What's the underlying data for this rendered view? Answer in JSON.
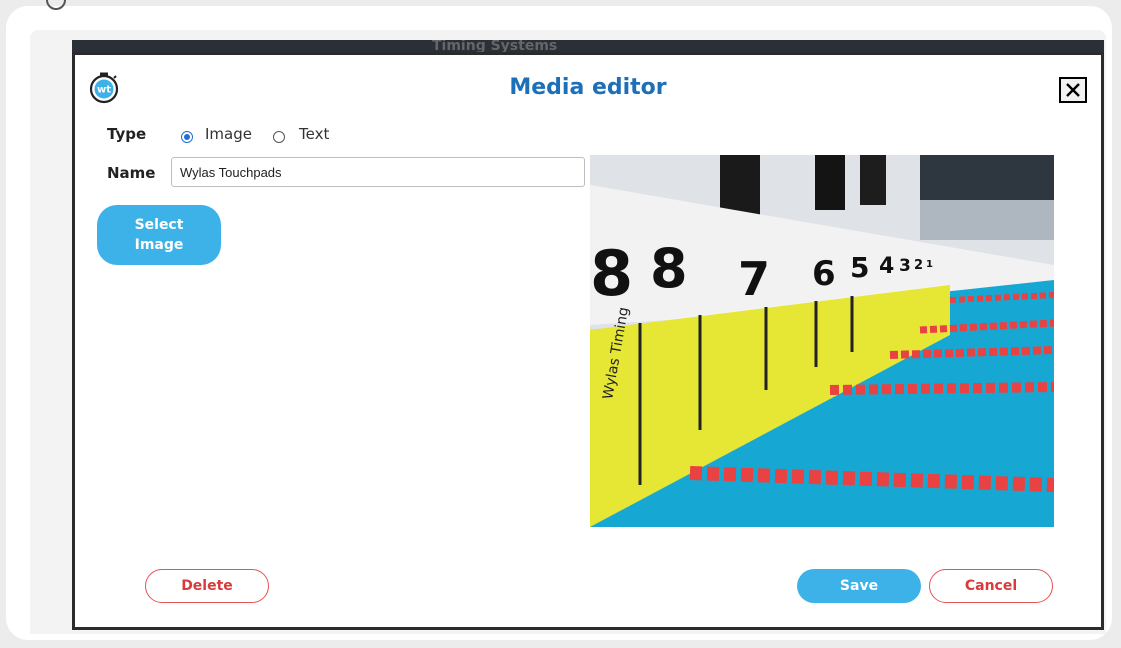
{
  "modal": {
    "title": "Media editor",
    "logo_text": "wt",
    "close_label": "✕"
  },
  "form": {
    "type_label": "Type",
    "type_options": [
      "Image",
      "Text"
    ],
    "type_selected": "Image",
    "name_label": "Name",
    "name_value": "Wylas Touchpads",
    "select_image_label_line1": "Select",
    "select_image_label_line2": "Image"
  },
  "preview": {
    "lane_numbers": [
      "8",
      "8",
      "7",
      "6",
      "5",
      "4",
      "3",
      "2",
      "1"
    ],
    "touchpad_brand": "Wylas Timing"
  },
  "buttons": {
    "delete": "Delete",
    "save": "Save",
    "cancel": "Cancel"
  },
  "background": {
    "partial_text": "Timing Systems"
  },
  "colors": {
    "title": "#1d6fb8",
    "primary": "#3db2e9",
    "danger": "#d93a3a"
  }
}
